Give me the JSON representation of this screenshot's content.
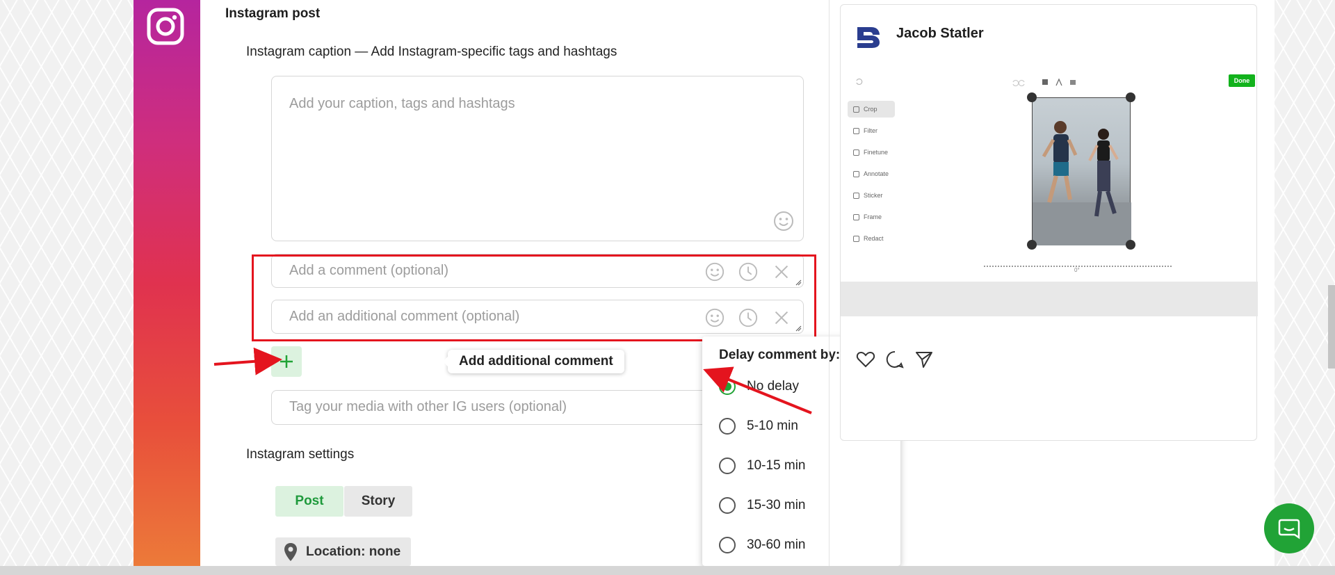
{
  "post": {
    "title": "Instagram post",
    "caption_label": "Instagram caption — Add Instagram-specific tags and hashtags",
    "caption_placeholder": "Add your caption, tags and hashtags",
    "comment_placeholder": "Add a comment (optional)",
    "additional_comment_placeholder": "Add an additional comment (optional)",
    "add_comment_tooltip": "Add additional comment",
    "tag_placeholder": "Tag your media with other IG users (optional)",
    "settings_label": "Instagram settings",
    "tabs": [
      "Post",
      "Story"
    ],
    "active_tab": "Post",
    "location_label": "Location: none"
  },
  "delay_menu": {
    "title": "Delay comment by:",
    "options": [
      "No delay",
      "5-10 min",
      "10-15 min",
      "15-30 min",
      "30-60 min"
    ],
    "selected": "No delay"
  },
  "preview": {
    "account_name": "Jacob Statler",
    "editor": {
      "tools": [
        "Crop",
        "Filter",
        "Finetune",
        "Annotate",
        "Sticker",
        "Frame",
        "Redact"
      ],
      "active_tool": "Crop",
      "done_label": "Done",
      "rotation_label": "0°"
    }
  },
  "colors": {
    "accent_green": "#21a336",
    "highlight_red": "#e4141e"
  }
}
